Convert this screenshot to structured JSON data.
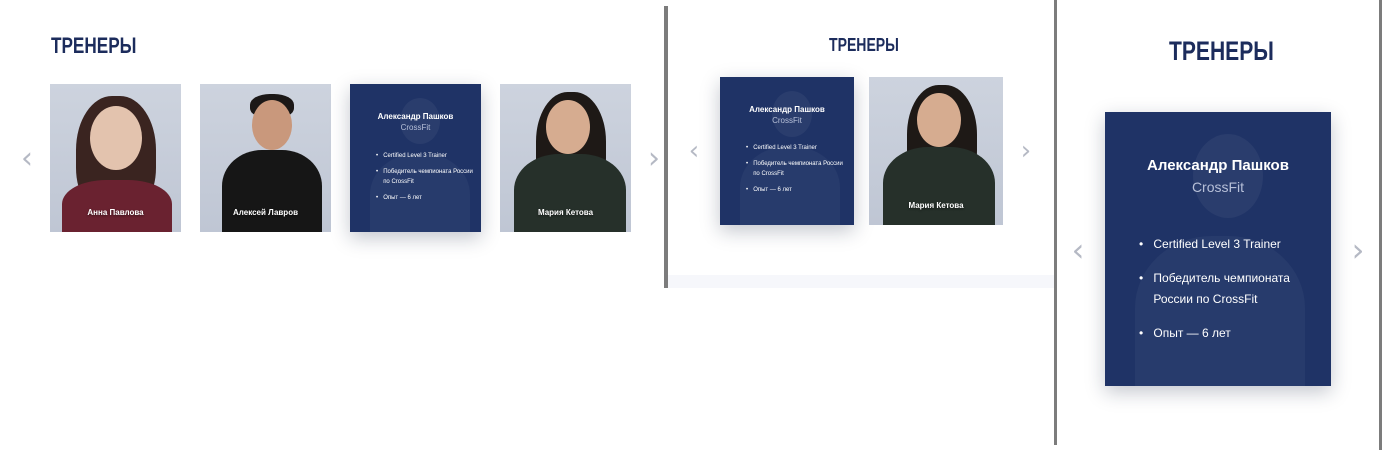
{
  "colors": {
    "primary": "#1c2c5c",
    "card_active": "#1f3366",
    "arrow": "#b5b9c4",
    "divider": "#7c7c7c"
  },
  "section_title": "ТРЕНЕРЫ",
  "arrows": {
    "prev": "‹",
    "next": "›",
    "prev_icon": "chevron-left-icon",
    "next_icon": "chevron-right-icon"
  },
  "trainers": [
    {
      "name": "Анна Павлова"
    },
    {
      "name": "Алексей Лавров"
    },
    {
      "name": "Александр Пашков",
      "discipline": "CrossFit",
      "achievements": [
        "Certified Level 3 Trainer",
        "Победитель чемпионата России по CrossFit",
        "Опыт — 6 лет"
      ]
    },
    {
      "name": "Мария Кетова"
    }
  ]
}
